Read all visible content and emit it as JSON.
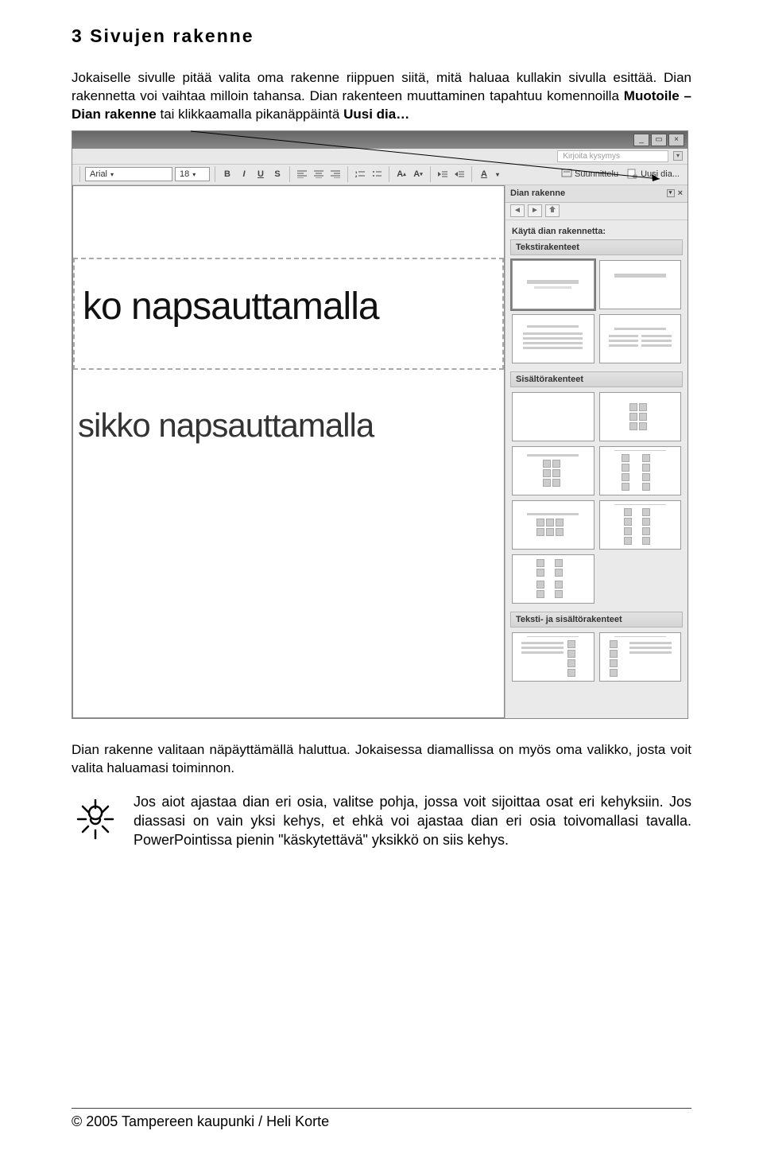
{
  "heading": "3 Sivujen rakenne",
  "para1_a": "Jokaiselle sivulle pitää valita oma rakenne riippuen siitä, mitä haluaa kullakin sivulla esittää. Dian rakennetta voi vaihtaa milloin tahansa. Dian rakenteen muuttaminen tapahtuu komennoilla ",
  "para1_bold1": "Muotoile – Dian rakenne",
  "para1_b": " tai klikkaamalla pikanäppäintä ",
  "para1_bold2": "Uusi dia…",
  "toolbar": {
    "font": "Arial",
    "size": "18",
    "suunnittelu": "Suunnittelu",
    "uusidia": "Uusi dia..."
  },
  "hintbar": {
    "placeholder": "Kirjoita kysymys"
  },
  "taskpane": {
    "title": "Dian rakenne",
    "uselabel": "Käytä dian rakennetta:",
    "cat1": "Tekstirakenteet",
    "cat2": "Sisältörakenteet",
    "cat3": "Teksti- ja sisältörakenteet"
  },
  "slide": {
    "line1": "ko napsauttamalla",
    "line2": "sikko napsauttamalla"
  },
  "para2": "Dian rakenne valitaan näpäyttämällä haluttua. Jokaisessa diamallissa on myös oma valikko, josta voit valita haluamasi toiminnon.",
  "tip": "Jos aiot ajastaa dian eri osia, valitse pohja, jossa voit sijoittaa osat eri kehyksiin. Jos diassasi on vain yksi kehys, et ehkä voi ajastaa dian eri osia toivomallasi tavalla. PowerPointissa pienin \"käskytettävä\" yksikkö on siis kehys.",
  "footer": "© 2005 Tampereen kaupunki / Heli Korte"
}
